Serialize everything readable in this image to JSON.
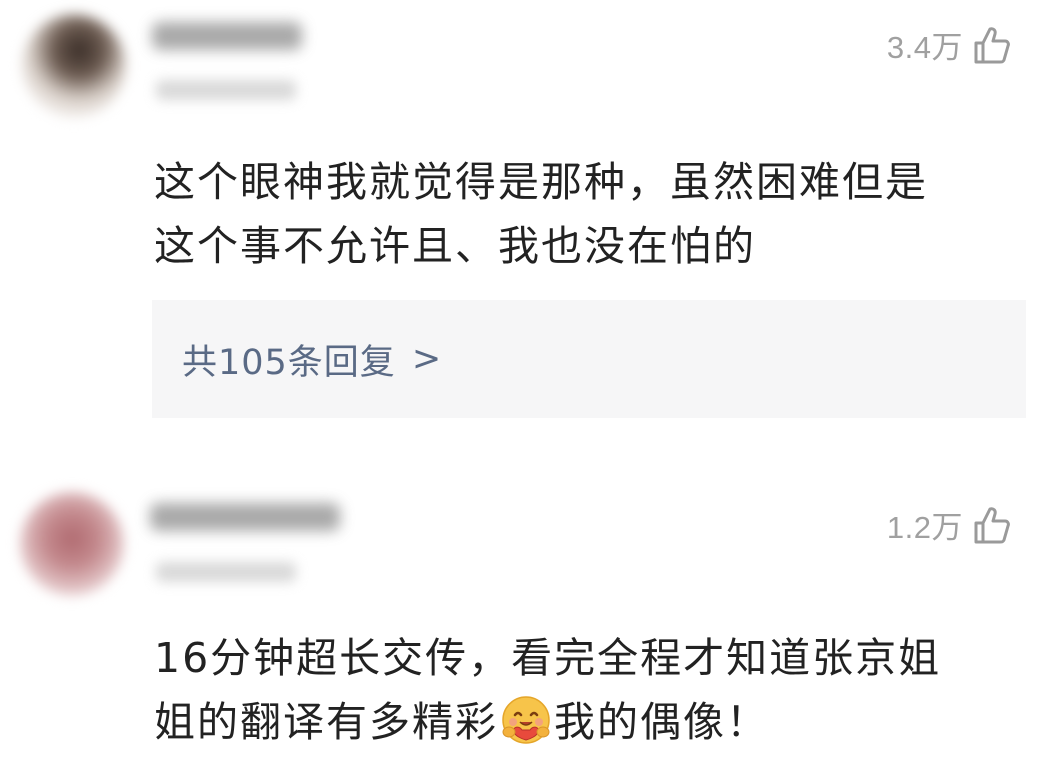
{
  "comments": [
    {
      "like_count": "3.4万",
      "text_lines": [
        "这个眼神我就觉得是那种，虽然困难但是",
        "这个事不允许且、我也没在怕的"
      ],
      "replies_label": "共105条回复",
      "replies_chevron": ">"
    },
    {
      "like_count": "1.2万",
      "text_line1": "16分钟超长交传，看完全程才知道张京姐",
      "text_line2_before": "姐的翻译有多精彩",
      "text_line2_after": "我的偶像！",
      "emoji_name": "hug-face-emoji"
    }
  ],
  "colors": {
    "like": "#a0a0a0",
    "text": "#222222",
    "replies_text": "#5a6a85",
    "replies_bg": "#f6f6f7"
  },
  "icons": {
    "like": "thumbs-up-icon"
  }
}
